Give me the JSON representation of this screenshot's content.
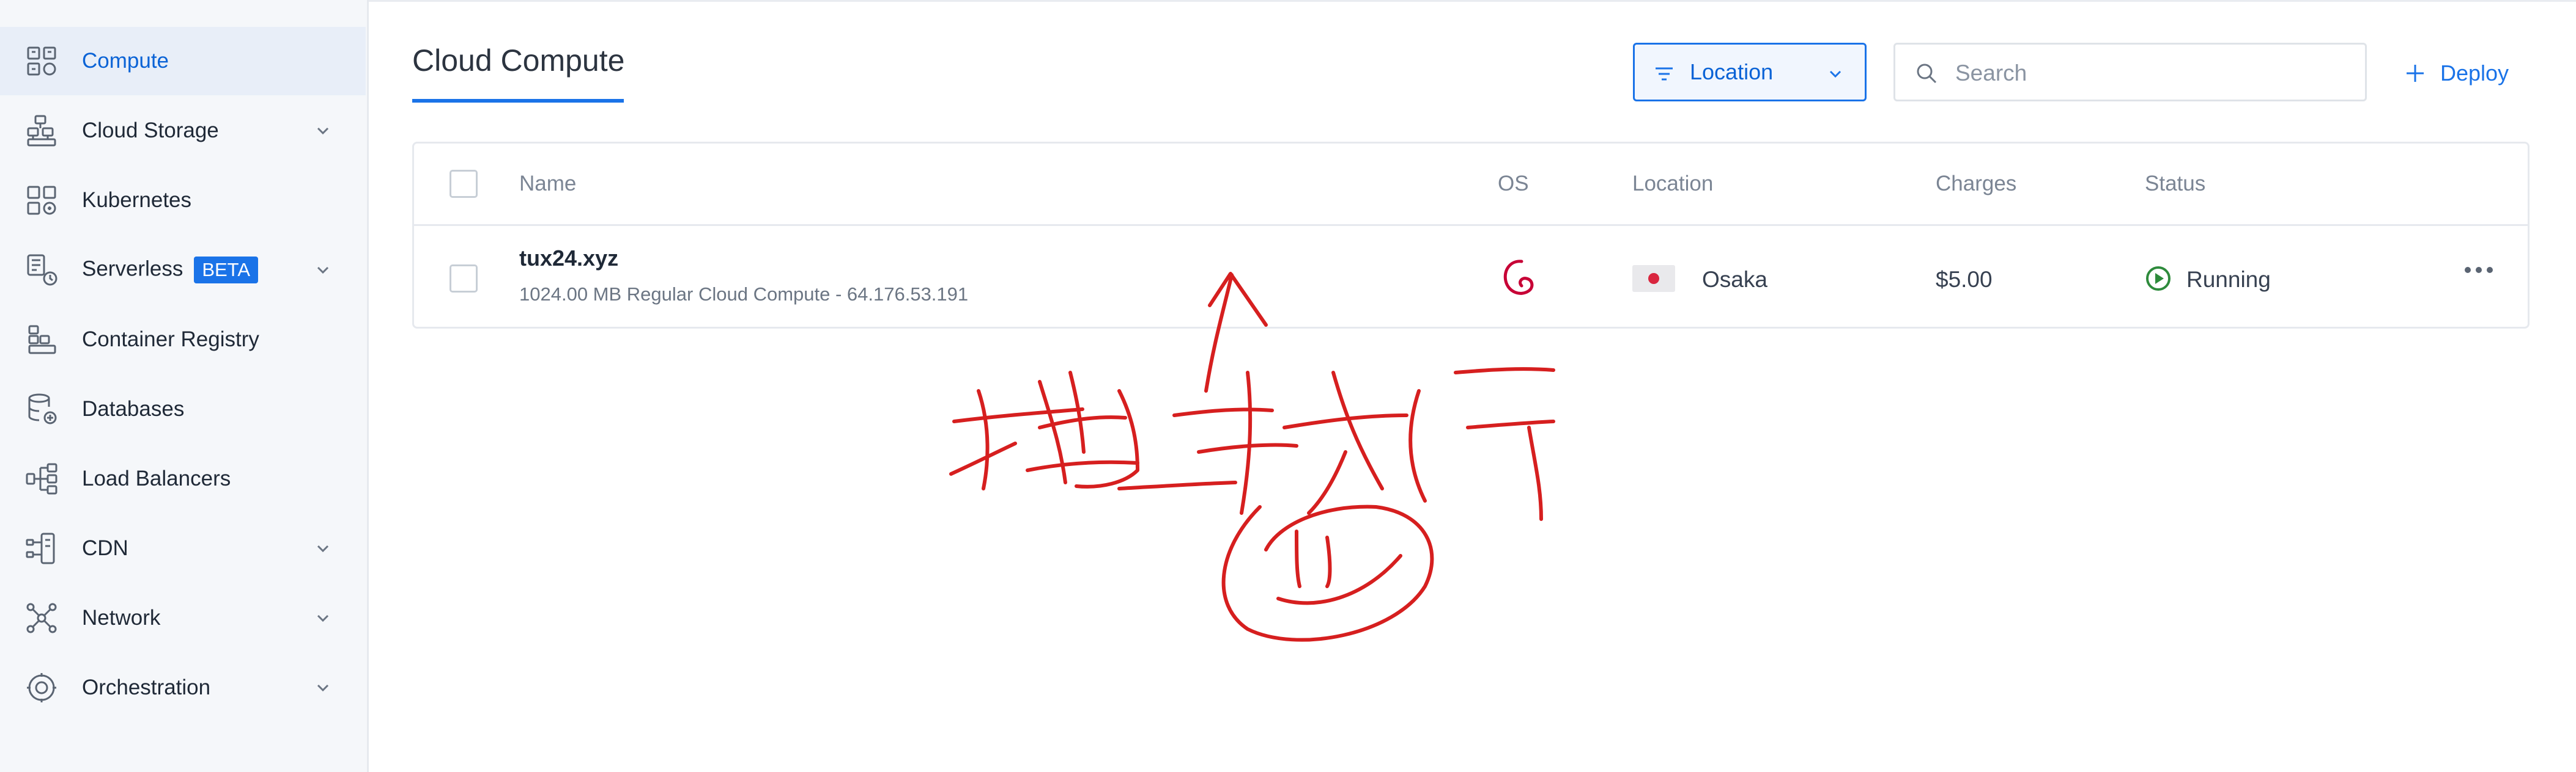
{
  "sidebar": {
    "items": [
      {
        "label": "Compute",
        "badge": "",
        "icon": "compute-icon",
        "chevron": false,
        "active": true
      },
      {
        "label": "Cloud Storage",
        "badge": "",
        "icon": "storage-icon",
        "chevron": true,
        "active": false
      },
      {
        "label": "Kubernetes",
        "badge": "",
        "icon": "kubernetes-icon",
        "chevron": false,
        "active": false
      },
      {
        "label": "Serverless",
        "badge": "BETA",
        "icon": "serverless-icon",
        "chevron": true,
        "active": false
      },
      {
        "label": "Container Registry",
        "badge": "",
        "icon": "registry-icon",
        "chevron": false,
        "active": false
      },
      {
        "label": "Databases",
        "badge": "",
        "icon": "database-icon",
        "chevron": false,
        "active": false
      },
      {
        "label": "Load Balancers",
        "badge": "",
        "icon": "load-balancer-icon",
        "chevron": false,
        "active": false
      },
      {
        "label": "CDN",
        "badge": "",
        "icon": "cdn-icon",
        "chevron": true,
        "active": false
      },
      {
        "label": "Network",
        "badge": "",
        "icon": "network-icon",
        "chevron": true,
        "active": false
      },
      {
        "label": "Orchestration",
        "badge": "",
        "icon": "orchestration-icon",
        "chevron": true,
        "active": false
      }
    ]
  },
  "header": {
    "title": "Cloud Compute",
    "location_filter_label": "Location",
    "search_placeholder": "Search",
    "deploy_label": "Deploy"
  },
  "table": {
    "columns": {
      "name": "Name",
      "os": "OS",
      "location": "Location",
      "charges": "Charges",
      "status": "Status"
    },
    "rows": [
      {
        "name": "tux24.xyz",
        "description": "1024.00 MB Regular Cloud Compute - 64.176.53.191",
        "os_icon": "debian-icon",
        "location_flag": "japan-flag-icon",
        "location": "Osaka",
        "charges": "$5.00",
        "status": "Running"
      }
    ]
  },
  "colors": {
    "accent": "#1a73e8",
    "status_running": "#2e8b3c",
    "debian_red": "#c70036",
    "annotation_red": "#d61f1f",
    "sidebar_bg": "#f5f7fa"
  }
}
